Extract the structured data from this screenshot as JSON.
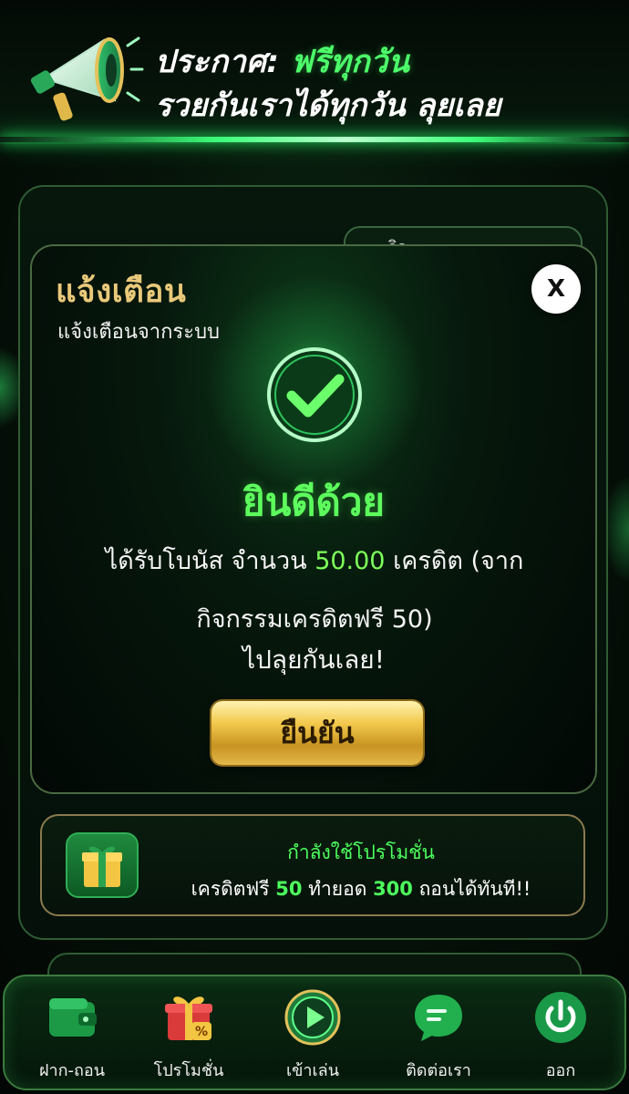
{
  "announcement": {
    "label": "ประกาศ:",
    "highlight": "ฟรีทุกวัน",
    "line2": "รวยกันเราได้ทุกวัน ลุยเลย",
    "icon": "megaphone-icon"
  },
  "background": {
    "card_text": "กิจ"
  },
  "modal": {
    "title": "แจ้งเตือน",
    "subtitle": "แจ้งเตือนจากระบบ",
    "close_label": "X",
    "success_title": "ยินดีด้วย",
    "message_prefix": "ได้รับโบนัส จำนวน",
    "amount": "50.00",
    "message_suffix": "เครดิต (จากกิจกรรมเครดิตฟรี 50)",
    "message_go": "ไปลุยกันเลย!",
    "confirm_label": "ยืนยัน"
  },
  "promo": {
    "title": "กำลังใช้โปรโมชั่น",
    "desc_part1": "เครดิตฟรี",
    "desc_num1": "50",
    "desc_part2": "ทำยอด",
    "desc_num2": "300",
    "desc_part3": "ถอนได้ทันที!!"
  },
  "nav": {
    "items": [
      {
        "label": "ฝาก-ถอน",
        "icon": "wallet-icon"
      },
      {
        "label": "โปรโมชั่น",
        "icon": "gift-icon"
      },
      {
        "label": "เข้าเล่น",
        "icon": "play-icon"
      },
      {
        "label": "ติดต่อเรา",
        "icon": "chat-icon"
      },
      {
        "label": "ออก",
        "icon": "power-icon"
      }
    ]
  },
  "colors": {
    "accent_green": "#4dff5d",
    "gold": "#e9c97a",
    "background": "#061309"
  }
}
